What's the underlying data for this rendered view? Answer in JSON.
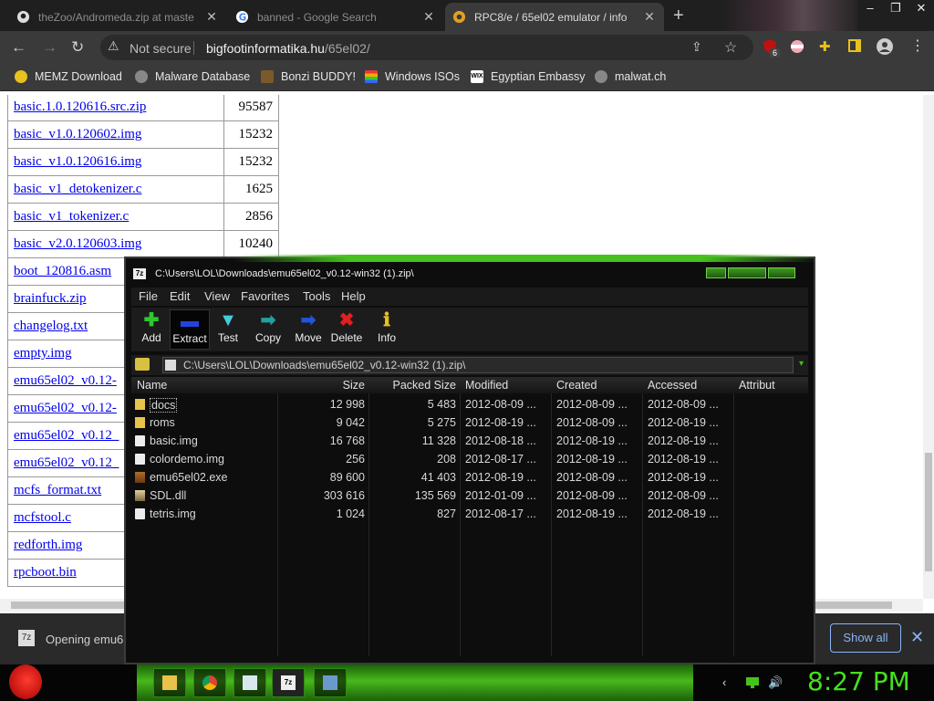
{
  "browser": {
    "tabs": [
      {
        "title": "theZoo/Andromeda.zip at maste",
        "active": false
      },
      {
        "title": "banned - Google Search",
        "active": false
      },
      {
        "title": "RPC8/e / 65el02 emulator / info",
        "active": true
      }
    ],
    "new_tab": "+",
    "address": {
      "security_label": "Not secure",
      "host": "bigfootinformatika.hu",
      "path": "/65el02/"
    },
    "extension_badge": "6",
    "bookmarks": [
      "MEMZ Download",
      "Malware Database",
      "Bonzi BUDDY!",
      "Windows ISOs",
      "Egyptian Embassy",
      "malwat.ch"
    ]
  },
  "page": {
    "files": [
      {
        "name": "basic.1.0.120616.src.zip",
        "size": "95587"
      },
      {
        "name": "basic_v1.0.120602.img",
        "size": "15232"
      },
      {
        "name": "basic_v1.0.120616.img",
        "size": "15232"
      },
      {
        "name": "basic_v1_detokenizer.c",
        "size": "1625"
      },
      {
        "name": "basic_v1_tokenizer.c",
        "size": "2856"
      },
      {
        "name": "basic_v2.0.120603.img",
        "size": "10240"
      },
      {
        "name": "boot_120816.asm",
        "size": ""
      },
      {
        "name": "brainfuck.zip",
        "size": ""
      },
      {
        "name": "changelog.txt",
        "size": ""
      },
      {
        "name": "empty.img",
        "size": ""
      },
      {
        "name": "emu65el02_v0.12-",
        "size": ""
      },
      {
        "name": "emu65el02_v0.12-",
        "size": ""
      },
      {
        "name": "emu65el02_v0.12_",
        "size": ""
      },
      {
        "name": "emu65el02_v0.12_",
        "size": ""
      },
      {
        "name": "mcfs_format.txt",
        "size": ""
      },
      {
        "name": "mcfstool.c",
        "size": ""
      },
      {
        "name": "redforth.img",
        "size": ""
      },
      {
        "name": "rpcboot.bin",
        "size": ""
      }
    ]
  },
  "download_bar": {
    "item_text": "Opening emu6",
    "show_all": "Show all",
    "close": "✕"
  },
  "zip": {
    "title": "C:\\Users\\LOL\\Downloads\\emu65el02_v0.12-win32 (1).zip\\",
    "menu": [
      "File",
      "Edit",
      "View",
      "Favorites",
      "Tools",
      "Help"
    ],
    "toolbar": [
      {
        "label": "Add",
        "icon": "plus-icon",
        "color": "#2ec82e"
      },
      {
        "label": "Extract",
        "icon": "extract-icon",
        "color": "#2244dd"
      },
      {
        "label": "Test",
        "icon": "test-icon",
        "color": "#44ccdd"
      },
      {
        "label": "Copy",
        "icon": "copy-icon",
        "color": "#22a0a0"
      },
      {
        "label": "Move",
        "icon": "move-icon",
        "color": "#2255dd"
      },
      {
        "label": "Delete",
        "icon": "delete-icon",
        "color": "#e02020"
      },
      {
        "label": "Info",
        "icon": "info-icon",
        "color": "#e8c020"
      }
    ],
    "path": "C:\\Users\\LOL\\Downloads\\emu65el02_v0.12-win32 (1).zip\\",
    "columns": [
      "Name",
      "Size",
      "Packed Size",
      "Modified",
      "Created",
      "Accessed",
      "Attribut"
    ],
    "rows": [
      {
        "name": "docs",
        "type": "folder",
        "size": "12 998",
        "packed": "5 483",
        "modified": "2012-08-09 ...",
        "created": "2012-08-09 ...",
        "accessed": "2012-08-09 ..."
      },
      {
        "name": "roms",
        "type": "folder",
        "size": "9 042",
        "packed": "5 275",
        "modified": "2012-08-19 ...",
        "created": "2012-08-09 ...",
        "accessed": "2012-08-19 ..."
      },
      {
        "name": "basic.img",
        "type": "img",
        "size": "16 768",
        "packed": "11 328",
        "modified": "2012-08-18 ...",
        "created": "2012-08-19 ...",
        "accessed": "2012-08-19 ..."
      },
      {
        "name": "colordemo.img",
        "type": "img",
        "size": "256",
        "packed": "208",
        "modified": "2012-08-17 ...",
        "created": "2012-08-19 ...",
        "accessed": "2012-08-19 ..."
      },
      {
        "name": "emu65el02.exe",
        "type": "exe",
        "size": "89 600",
        "packed": "41 403",
        "modified": "2012-08-19 ...",
        "created": "2012-08-09 ...",
        "accessed": "2012-08-19 ..."
      },
      {
        "name": "SDL.dll",
        "type": "dll",
        "size": "303 616",
        "packed": "135 569",
        "modified": "2012-01-09 ...",
        "created": "2012-08-09 ...",
        "accessed": "2012-08-09 ..."
      },
      {
        "name": "tetris.img",
        "type": "img",
        "size": "1 024",
        "packed": "827",
        "modified": "2012-08-17 ...",
        "created": "2012-08-19 ...",
        "accessed": "2012-08-19 ..."
      }
    ]
  },
  "taskbar": {
    "clock": "8:27 PM"
  }
}
